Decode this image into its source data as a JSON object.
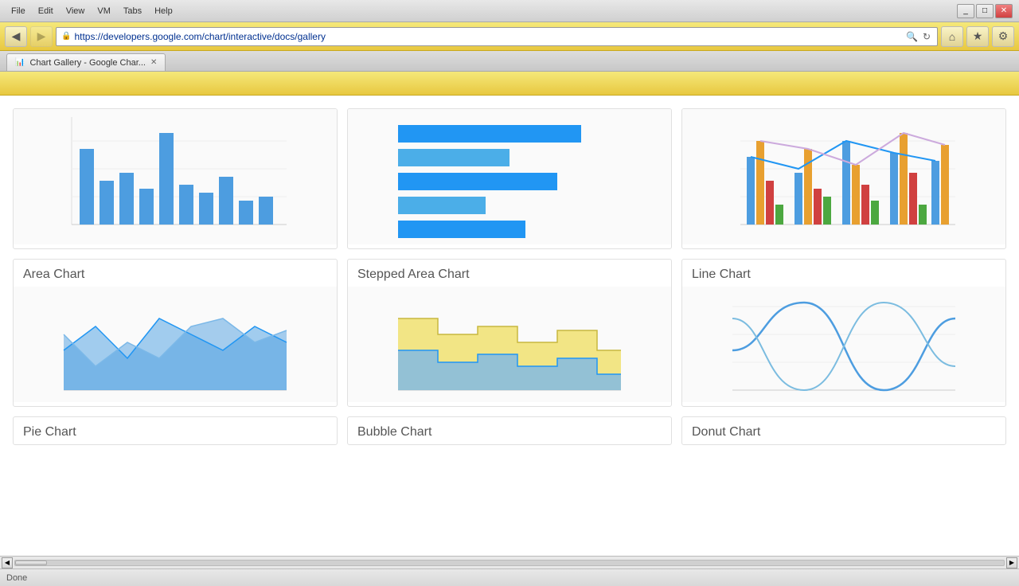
{
  "titlebar": {
    "menu_items": [
      "File",
      "Edit",
      "View",
      "VM",
      "Tabs",
      "Help"
    ],
    "window_controls": [
      "_",
      "□",
      "✕"
    ]
  },
  "navbar": {
    "back_label": "◀",
    "forward_label": "▶",
    "url": "https://developers.google.com/chart/interactive/docs/gallery",
    "refresh_label": "↻",
    "lock_label": "🔒",
    "search_label": "🔍",
    "home_label": "⌂",
    "star_label": "★",
    "tools_label": "⚙"
  },
  "tabs": [
    {
      "label": "Chart Gallery - Google Char...",
      "favicon": "📊",
      "active": true
    }
  ],
  "toolbar": {
    "back_disabled": false,
    "forward_disabled": true
  },
  "charts": [
    {
      "id": "bar-chart",
      "title": "",
      "type": "bar_vertical"
    },
    {
      "id": "horizontal-bar-chart",
      "title": "",
      "type": "bar_horizontal"
    },
    {
      "id": "combo-chart",
      "title": "",
      "type": "combo"
    },
    {
      "id": "area-chart",
      "title": "Area Chart",
      "type": "area"
    },
    {
      "id": "stepped-area-chart",
      "title": "Stepped Area Chart",
      "type": "stepped_area"
    },
    {
      "id": "line-chart",
      "title": "Line Chart",
      "type": "line"
    },
    {
      "id": "pie-chart",
      "title": "Pie Chart",
      "type": "pie"
    },
    {
      "id": "bubble-chart",
      "title": "Bubble Chart",
      "type": "bubble"
    },
    {
      "id": "donut-chart",
      "title": "Donut Chart",
      "type": "donut"
    }
  ],
  "status": {
    "text": "Done"
  }
}
